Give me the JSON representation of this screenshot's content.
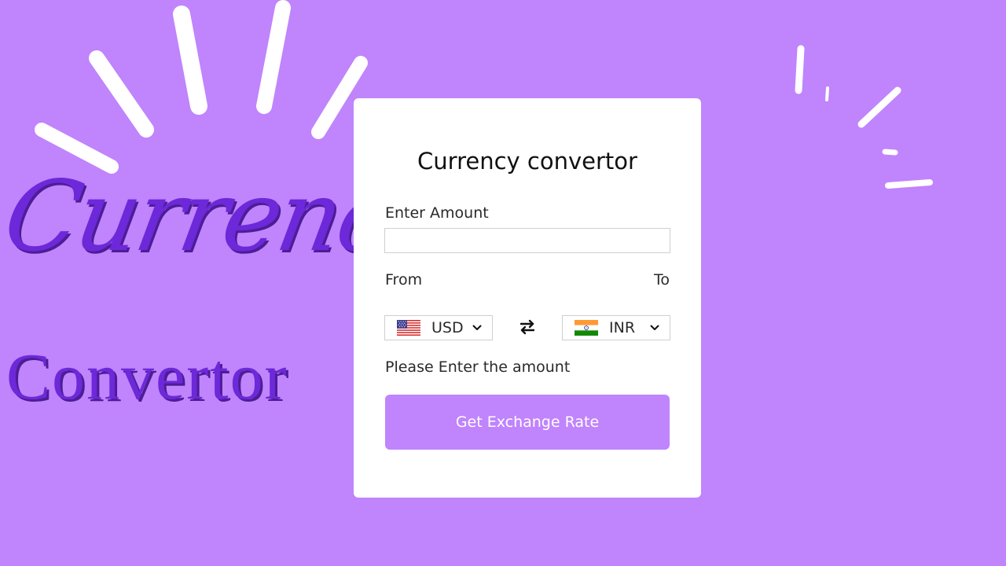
{
  "hero": {
    "line1": "Currency",
    "line2": "Convertor"
  },
  "card": {
    "title": "Currency convertor",
    "amount_label": "Enter Amount",
    "amount_value": "",
    "from_label": "From",
    "to_label": "To",
    "from_currency": "USD",
    "to_currency": "INR",
    "message": "Please Enter the amount",
    "button_label": "Get Exchange Rate"
  },
  "icons": {
    "from_flag": "us-flag-icon",
    "to_flag": "india-flag-icon",
    "swap": "swap-arrows-icon",
    "dropdown": "chevron-down-icon"
  },
  "colors": {
    "background": "#c084fc",
    "card": "#ffffff",
    "button": "#c084fc",
    "hero_text": "#6d28d9",
    "hero_shadow": "#4c1d95"
  }
}
